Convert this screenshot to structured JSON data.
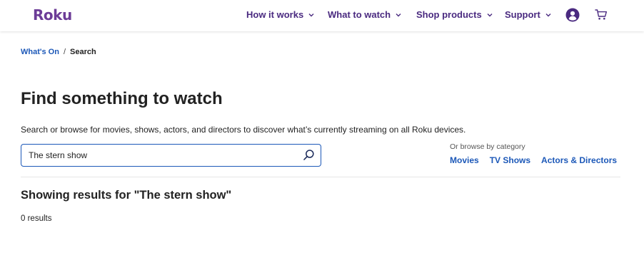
{
  "header": {
    "logo": "Roku",
    "nav": [
      {
        "label": "How it works"
      },
      {
        "label": "What to watch"
      },
      {
        "label": "Shop products"
      },
      {
        "label": "Support"
      }
    ]
  },
  "breadcrumb": {
    "link": "What's On",
    "separator": "/",
    "current": "Search"
  },
  "main": {
    "title": "Find something to watch",
    "intro": "Search or browse for movies, shows, actors, and directors to discover what’s currently streaming on all Roku devices.",
    "search": {
      "value": "The stern show"
    },
    "browse": {
      "label": "Or browse by category",
      "links": [
        "Movies",
        "TV Shows",
        "Actors & Directors"
      ]
    },
    "results": {
      "heading": "Showing results for \"The stern show\"",
      "count": "0 results"
    }
  },
  "colors": {
    "brand": "#6c3c97",
    "nav": "#4a2a80",
    "link": "#1c58b8"
  },
  "icons": {
    "user": "user-circle-icon",
    "cart": "cart-icon",
    "search": "search-icon",
    "chevron": "chevron-down-icon"
  }
}
